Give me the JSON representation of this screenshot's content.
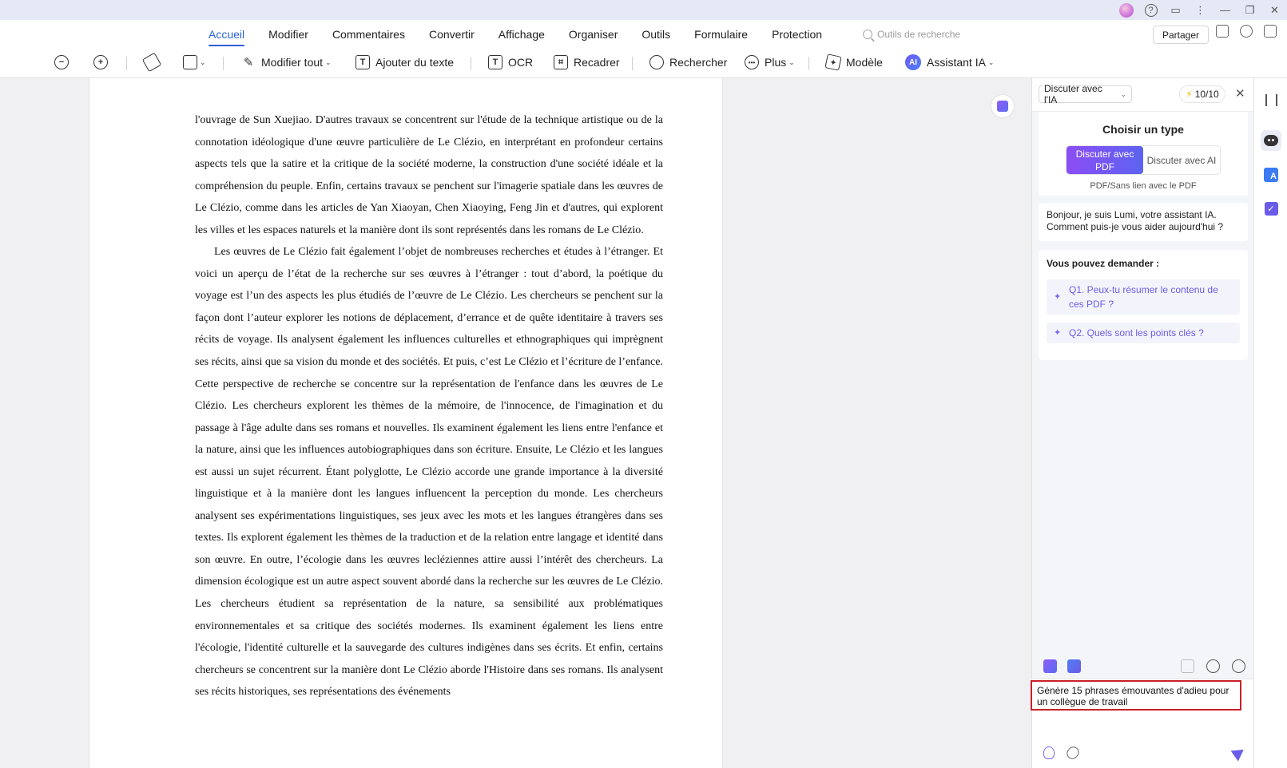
{
  "menu": {
    "tabs": [
      "Accueil",
      "Modifier",
      "Commentaires",
      "Convertir",
      "Affichage",
      "Organiser",
      "Outils",
      "Formulaire",
      "Protection"
    ],
    "search_placeholder": "Outils de recherche",
    "share_label": "Partager"
  },
  "toolbar": {
    "edit_all": "Modifier tout",
    "add_text": "Ajouter du texte",
    "ocr": "OCR",
    "crop": "Recadrer",
    "search": "Rechercher",
    "more": "Plus",
    "template": "Modèle",
    "ai_badge": "AI",
    "assistant": "Assistant IA"
  },
  "document": {
    "paragraphs": [
      "l'ouvrage de Sun Xuejiao. D'autres travaux se concentrent sur l'étude de la technique artistique ou de la connotation idéologique d'une œuvre particulière de Le Clézio, en interprétant en profondeur certains aspects tels que la satire et la critique de la société moderne, la construction d'une société idéale et la compréhension du peuple. Enfin, certains travaux se penchent sur l'imagerie spatiale dans les œuvres de Le Clézio, comme dans les articles de Yan Xiaoyan, Chen Xiaoying, Feng Jin et d'autres, qui explorent les villes et les espaces naturels et la manière dont ils sont représentés dans les romans de Le Clézio.",
      "Les œuvres de Le Clézio fait également l’objet de nombreuses recherches et études à l’étranger. Et voici un aperçu de l’état de la recherche sur ses œuvres à l’étranger : tout d’abord, la poétique du voyage est l’un des aspects les plus étudiés de l’œuvre de Le Clézio. Les chercheurs se penchent sur la façon dont l’auteur explorer les notions de déplacement, d’errance et de quête identitaire à travers ses récits de voyage. Ils analysent également les influences culturelles et ethnographiques qui imprègnent ses récits, ainsi que sa vision du monde et des sociétés. Et puis, c’est Le Clézio et l’écriture de l’enfance. Cette perspective de recherche se concentre sur la représentation de l'enfance dans les œuvres de Le Clézio. Les chercheurs explorent les thèmes de la mémoire, de l'innocence, de l'imagination et du passage à l'âge adulte dans ses romans et nouvelles. Ils examinent également les liens entre l'enfance et la nature, ainsi que les influences autobiographiques dans son écriture. Ensuite, Le Clézio et les langues est aussi un sujet récurrent. Étant polyglotte, Le Clézio accorde une grande importance à la diversité linguistique et à la manière dont les langues influencent la perception du monde. Les chercheurs analysent ses expérimentations linguistiques, ses jeux avec les mots et les langues étrangères dans ses textes. Ils explorent également les thèmes de la traduction et de la relation entre langage et identité dans son œuvre. En outre, l’écologie dans les œuvres lecléziennes attire aussi l’intérêt des chercheurs. La dimension écologique est un autre aspect souvent abordé dans la recherche sur les œuvres de Le Clézio. Les chercheurs étudient sa représentation de la nature, sa sensibilité aux problématiques environnementales et sa critique des sociétés modernes. Ils examinent également les liens entre l'écologie, l'identité culturelle et la sauvegarde des cultures indigènes dans ses écrits. Et enfin, certains chercheurs se concentrent sur la manière dont Le Clézio aborde l'Histoire dans ses romans. Ils analysent ses récits historiques, ses représentations des événements"
    ]
  },
  "ai_panel": {
    "mode_select": "Discuter avec l'IA",
    "credits": "10/10",
    "choose_type_title": "Choisir un type",
    "type_pdf": "Discuter avec PDF",
    "type_ai": "Discuter avec AI",
    "type_subtitle": "PDF/Sans lien avec le PDF",
    "greeting": "Bonjour, je suis Lumi, votre assistant IA. Comment puis-je vous aider aujourd'hui ?",
    "ask_title": "Vous pouvez demander :",
    "questions": [
      "Q1. Peux-tu résumer le contenu de ces PDF ?",
      "Q2. Quels sont les points clés ?"
    ],
    "input_value": "Génère 15 phrases émouvantes d'adieu pour un collègue de travail"
  },
  "colors": {
    "accent_blue": "#2a62d9",
    "ai_purple": "#6a5ce8",
    "highlight_red": "#c9202a"
  },
  "icons": [
    "zoom-out-icon",
    "zoom-in-icon",
    "highlighter-icon",
    "rectangle-icon",
    "pen-icon",
    "text-icon",
    "ocr-icon",
    "crop-icon",
    "search-icon",
    "more-icon",
    "template-icon",
    "lightning-icon",
    "close-icon",
    "sparkle-icon",
    "history-icon",
    "settings-icon",
    "lightbulb-icon",
    "attach-icon",
    "send-icon"
  ]
}
